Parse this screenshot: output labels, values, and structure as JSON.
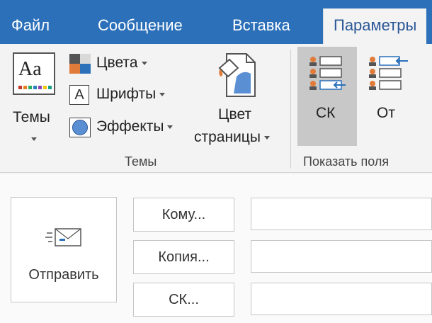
{
  "tabs": [
    {
      "label": "Файл"
    },
    {
      "label": "Сообщение"
    },
    {
      "label": "Вставка"
    },
    {
      "label": "Параметры"
    }
  ],
  "ribbon": {
    "themes_group": {
      "label": "Темы",
      "themes_button": "Темы",
      "theme_icon_text": "Aa",
      "colors": "Цвета",
      "fonts": "Шрифты",
      "font_icon_text": "A",
      "effects": "Эффекты",
      "page_color_line1": "Цвет",
      "page_color_line2": "страницы"
    },
    "show_fields_group": {
      "label": "Показать поля",
      "bcc": "СК",
      "from": "От"
    }
  },
  "compose": {
    "send": "Отправить",
    "to": "Кому...",
    "cc": "Копия...",
    "bcc": "СК..."
  },
  "colors": {
    "tabbar": "#2b70b9",
    "active_tab_text": "#2b5797",
    "ribbon_bg": "#f3f3f3",
    "selected_bg": "#c8c8c8",
    "accent_blue": "#2b70b9"
  }
}
